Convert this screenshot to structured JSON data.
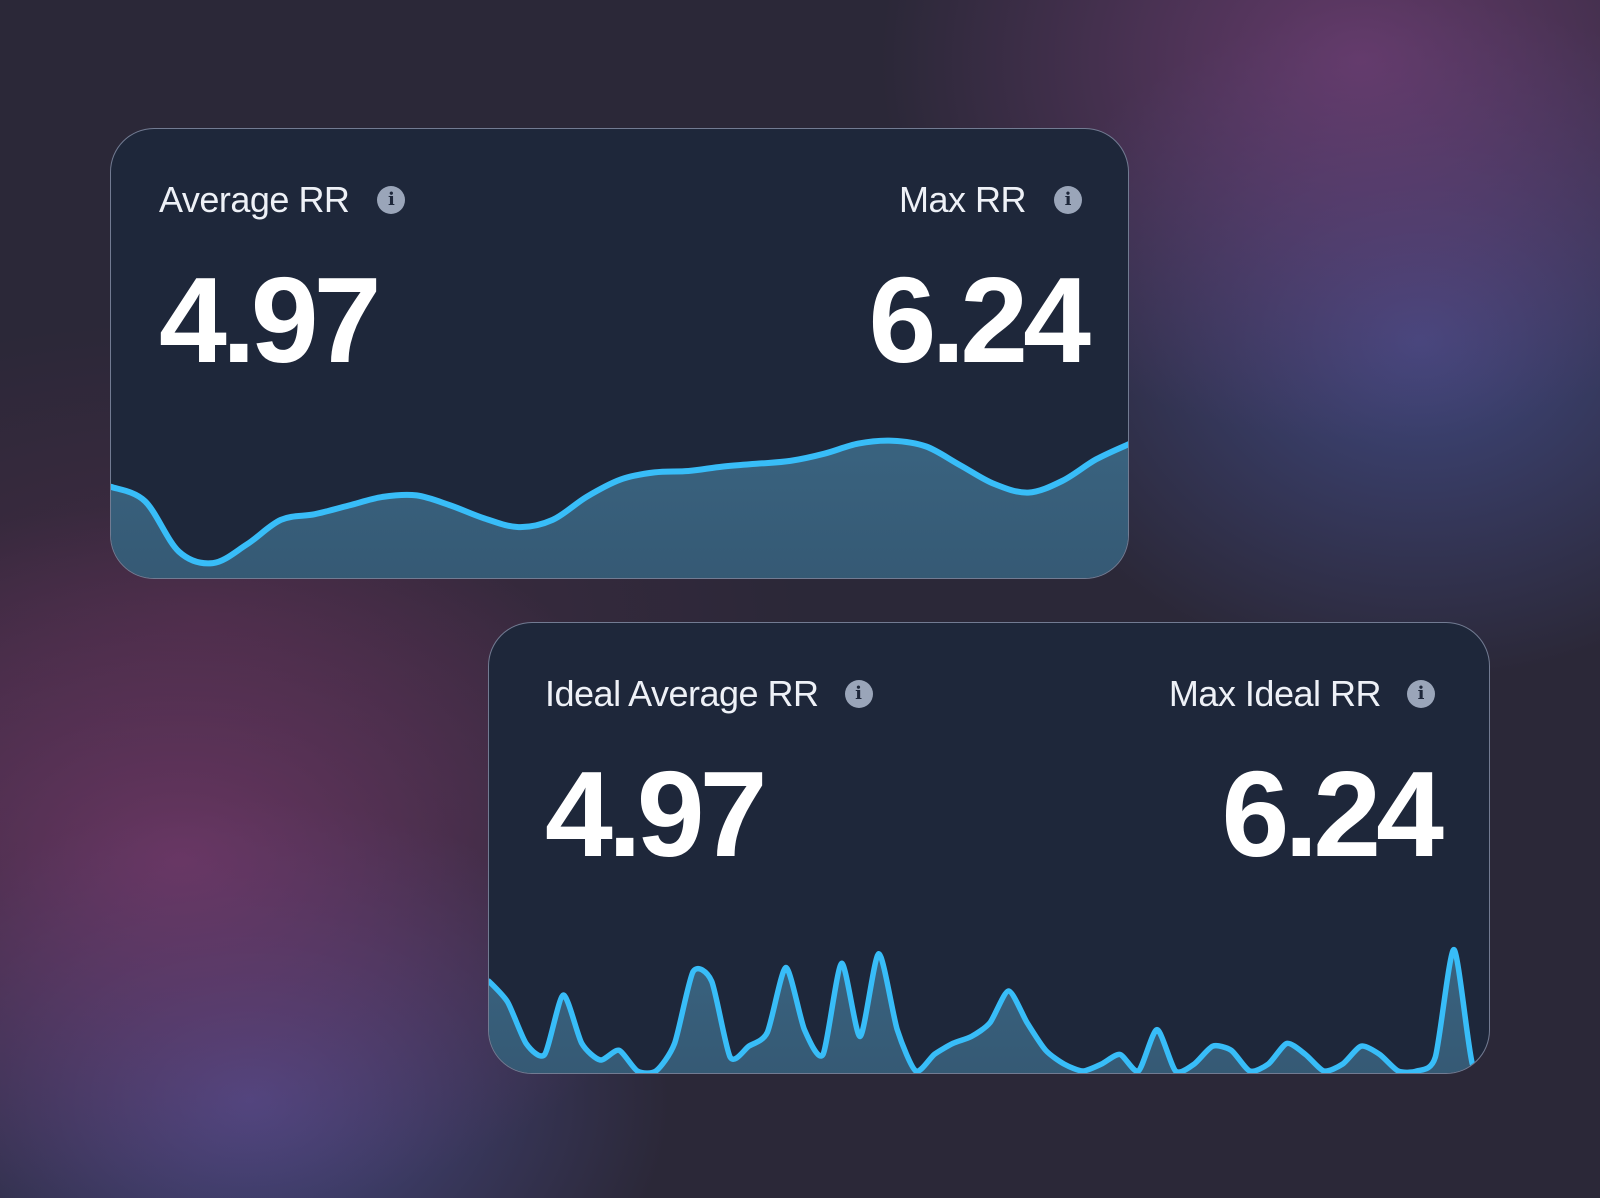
{
  "cards": [
    {
      "left_metric": {
        "label": "Average RR",
        "value": "4.97"
      },
      "right_metric": {
        "label": "Max RR",
        "value": "6.24"
      }
    },
    {
      "left_metric": {
        "label": "Ideal Average RR",
        "value": "4.97"
      },
      "right_metric": {
        "label": "Max Ideal RR",
        "value": "6.24"
      }
    }
  ],
  "info_icon_glyph": "i",
  "colors": {
    "card_background": "#1e273a",
    "line": "#38bdf8",
    "area_fill": "#3b6683",
    "label_text": "#eef1f7",
    "value_text": "#ffffff",
    "info_icon": "#9aa5b9"
  },
  "chart_data": [
    {
      "type": "area",
      "values": [
        0.55,
        0.45,
        0.1,
        0.02,
        0.15,
        0.32,
        0.36,
        0.42,
        0.48,
        0.49,
        0.42,
        0.33,
        0.27,
        0.32,
        0.48,
        0.6,
        0.65,
        0.66,
        0.69,
        0.71,
        0.73,
        0.78,
        0.85,
        0.87,
        0.83,
        0.7,
        0.57,
        0.51,
        0.59,
        0.74,
        0.85
      ],
      "ylim": [
        0,
        1
      ],
      "grid": false
    },
    {
      "type": "area",
      "values": [
        0.65,
        0.5,
        0.2,
        0.12,
        0.55,
        0.2,
        0.08,
        0.15,
        0.0,
        0.0,
        0.2,
        0.72,
        0.65,
        0.1,
        0.18,
        0.28,
        0.75,
        0.3,
        0.12,
        0.78,
        0.25,
        0.85,
        0.3,
        0.0,
        0.12,
        0.2,
        0.25,
        0.35,
        0.58,
        0.35,
        0.15,
        0.05,
        0.0,
        0.05,
        0.12,
        0.0,
        0.3,
        0.0,
        0.05,
        0.18,
        0.15,
        0.0,
        0.05,
        0.2,
        0.12,
        0.0,
        0.05,
        0.18,
        0.12,
        0.0,
        0.0,
        0.1,
        0.88,
        0.05,
        0.0
      ],
      "ylim": [
        0,
        1
      ],
      "grid": false
    }
  ]
}
